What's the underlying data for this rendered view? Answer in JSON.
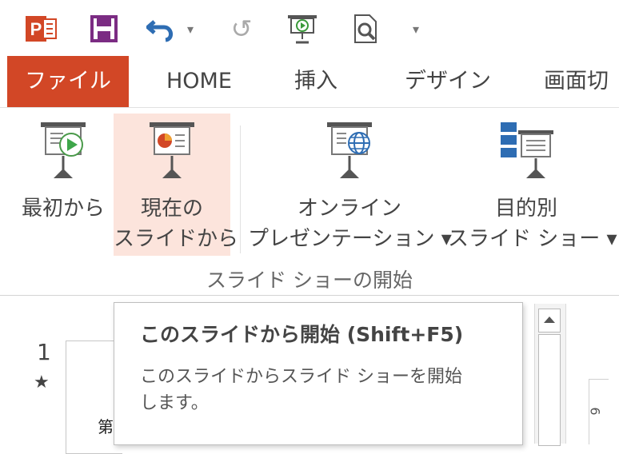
{
  "app": {
    "name": "PowerPoint"
  },
  "quick_access": {
    "items": [
      {
        "name": "app-icon",
        "glyph": "P"
      },
      {
        "name": "save-icon"
      },
      {
        "name": "undo-icon"
      },
      {
        "name": "undo-dropdown-icon",
        "glyph": "▾"
      },
      {
        "name": "redo-icon",
        "glyph": "↺"
      },
      {
        "name": "slideshow-start-icon"
      },
      {
        "name": "print-preview-icon"
      },
      {
        "name": "customize-qat-icon",
        "glyph": "▾"
      }
    ]
  },
  "tabs": [
    {
      "label": "ファイル",
      "active": true
    },
    {
      "label": "HOME"
    },
    {
      "label": "挿入"
    },
    {
      "label": "デザイン"
    },
    {
      "label": "画面切"
    }
  ],
  "ribbon": {
    "group_label": "スライド ショーの開始",
    "buttons": [
      {
        "label": "最初から"
      },
      {
        "label": "現在の\nスライドから",
        "highlighted": true
      },
      {
        "label": "オンライン\nプレゼンテーション ▾"
      },
      {
        "label": "目的別\nスライド ショー ▾"
      }
    ]
  },
  "slides": {
    "number": "1",
    "star": "★",
    "thumb_text": "第"
  },
  "ruler_text": "6",
  "tooltip": {
    "title": "このスライドから開始 (Shift+F5)",
    "description": "このスライドからスライド ショーを開始\nします。"
  },
  "colors": {
    "accent": "#d24726",
    "highlight": "#fce4dc",
    "save": "#7b2c83",
    "undo": "#2e6db3"
  }
}
